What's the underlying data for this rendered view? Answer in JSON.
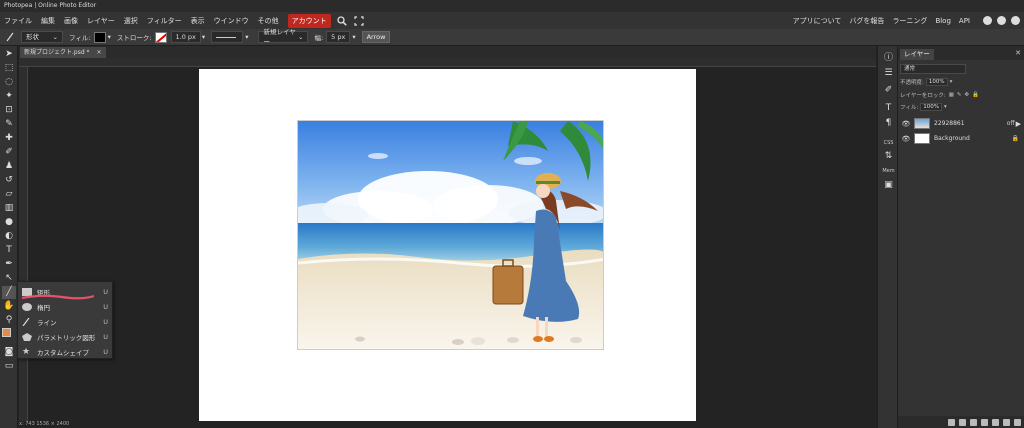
{
  "app": {
    "title": "Photopea | Online Photo Editor"
  },
  "menu": {
    "items": [
      "ファイル",
      "編集",
      "画像",
      "レイヤー",
      "選択",
      "フィルター",
      "表示",
      "ウインドウ",
      "その他"
    ],
    "account": "アカウント",
    "right_items": [
      "アプリについて",
      "バグを報告",
      "ラーニング",
      "Blog",
      "API"
    ]
  },
  "options": {
    "mode": "形状",
    "fill_label": "フィル:",
    "stroke_label": "ストローク:",
    "stroke_size": "1.0 px",
    "layer_target": "新規レイヤー",
    "width_label": "幅:",
    "width_value": "5 px",
    "arrow_button": "Arrow"
  },
  "document": {
    "tab_title": "新規プロジェクト.psd *",
    "tab_close": "✕"
  },
  "status": {
    "coords": "x: 743  1536 × 2400"
  },
  "flyout": {
    "items": [
      {
        "label": "矩形",
        "key": "U",
        "icon": "rectangle-icon"
      },
      {
        "label": "楕円",
        "key": "U",
        "icon": "ellipse-icon"
      },
      {
        "label": "ライン",
        "key": "U",
        "icon": "line-icon"
      },
      {
        "label": "パラメトリック図形",
        "key": "U",
        "icon": "polygon-icon"
      },
      {
        "label": "カスタムシェイプ",
        "key": "U",
        "icon": "star-icon"
      }
    ]
  },
  "mini_panel": {
    "css_label": "CSS",
    "mem_label": "Mem"
  },
  "layers": {
    "tab": "レイヤー",
    "blend": "通常",
    "opacity_label": "不透明度:",
    "opacity_value": "100%",
    "lock_label": "レイヤーをロック:",
    "fill_label": "フィル:",
    "fill_value": "100%",
    "items": [
      {
        "name": "22928861",
        "badge": "off"
      },
      {
        "name": "Background"
      }
    ]
  },
  "colors": {
    "accent": "#c0281f",
    "foreground": "#e8874a",
    "background": "#000000"
  }
}
